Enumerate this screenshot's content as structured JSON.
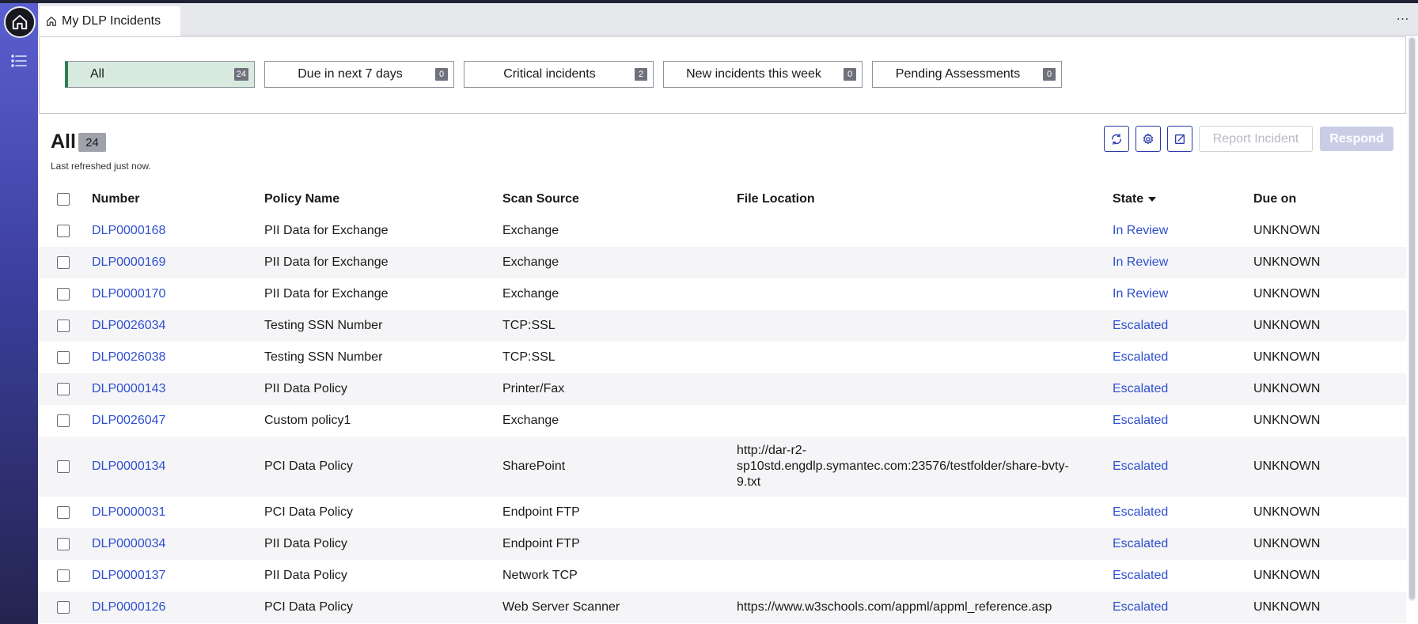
{
  "tab": {
    "title": "My DLP Incidents"
  },
  "filters": [
    {
      "label": "All",
      "count": "24"
    },
    {
      "label": "Due in next 7 days",
      "count": "0"
    },
    {
      "label": "Critical incidents",
      "count": "2"
    },
    {
      "label": "New incidents this week",
      "count": "0"
    },
    {
      "label": "Pending Assessments",
      "count": "0"
    }
  ],
  "list": {
    "title": "All",
    "count": "24",
    "refreshed": "Last refreshed just now."
  },
  "actions": {
    "report_label": "Report Incident",
    "respond_label": "Respond"
  },
  "columns": [
    "Number",
    "Policy Name",
    "Scan Source",
    "File Location",
    "State",
    "Due on"
  ],
  "rows": [
    {
      "number": "DLP0000168",
      "policy": "PII Data for Exchange",
      "source": "Exchange",
      "location": "",
      "state": "In Review",
      "due": "UNKNOWN"
    },
    {
      "number": "DLP0000169",
      "policy": "PII Data for Exchange",
      "source": "Exchange",
      "location": "",
      "state": "In Review",
      "due": "UNKNOWN"
    },
    {
      "number": "DLP0000170",
      "policy": "PII Data for Exchange",
      "source": "Exchange",
      "location": "",
      "state": "In Review",
      "due": "UNKNOWN"
    },
    {
      "number": "DLP0026034",
      "policy": "Testing SSN Number",
      "source": "TCP:SSL",
      "location": "",
      "state": "Escalated",
      "due": "UNKNOWN"
    },
    {
      "number": "DLP0026038",
      "policy": "Testing SSN Number",
      "source": "TCP:SSL",
      "location": "",
      "state": "Escalated",
      "due": "UNKNOWN"
    },
    {
      "number": "DLP0000143",
      "policy": "PII Data Policy",
      "source": "Printer/Fax",
      "location": "",
      "state": "Escalated",
      "due": "UNKNOWN"
    },
    {
      "number": "DLP0026047",
      "policy": "Custom policy1",
      "source": "Exchange",
      "location": "",
      "state": "Escalated",
      "due": "UNKNOWN"
    },
    {
      "number": "DLP0000134",
      "policy": "PCI Data Policy",
      "source": "SharePoint",
      "location": "http://dar-r2-sp10std.engdlp.symantec.com:23576/testfolder/share-bvty-9.txt",
      "state": "Escalated",
      "due": "UNKNOWN"
    },
    {
      "number": "DLP0000031",
      "policy": "PCI Data Policy",
      "source": "Endpoint FTP",
      "location": "",
      "state": "Escalated",
      "due": "UNKNOWN"
    },
    {
      "number": "DLP0000034",
      "policy": "PII Data Policy",
      "source": "Endpoint FTP",
      "location": "",
      "state": "Escalated",
      "due": "UNKNOWN"
    },
    {
      "number": "DLP0000137",
      "policy": "PII Data Policy",
      "source": "Network TCP",
      "location": "",
      "state": "Escalated",
      "due": "UNKNOWN"
    },
    {
      "number": "DLP0000126",
      "policy": "PCI Data Policy",
      "source": "Web Server Scanner",
      "location": "https://www.w3schools.com/appml/appml_reference.asp",
      "state": "Escalated",
      "due": "UNKNOWN"
    }
  ]
}
